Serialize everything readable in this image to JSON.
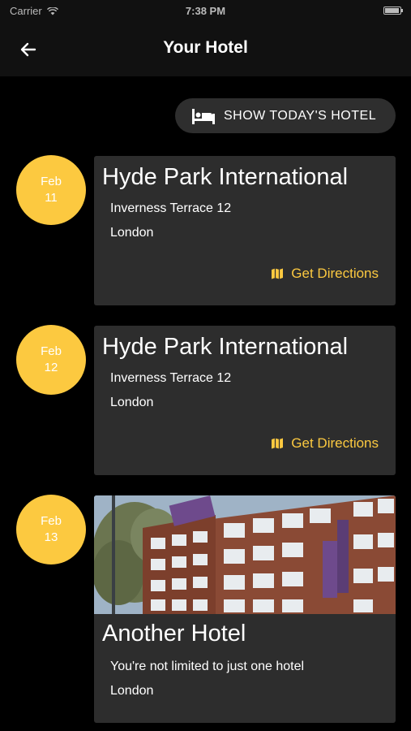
{
  "status": {
    "carrier": "Carrier",
    "time": "7:38 PM"
  },
  "nav": {
    "title": "Your Hotel"
  },
  "today_button": {
    "label": "SHOW TODAY'S HOTEL",
    "icon": "bed-icon"
  },
  "colors": {
    "accent": "#fcc940",
    "card": "#2d2d2d",
    "background": "#000000"
  },
  "bookings": [
    {
      "date": {
        "month": "Feb",
        "day": "11"
      },
      "hotel": "Hyde Park International",
      "line1": "Inverness Terrace 12",
      "line2": "London",
      "action": "Get Directions"
    },
    {
      "date": {
        "month": "Feb",
        "day": "12"
      },
      "hotel": "Hyde Park International",
      "line1": "Inverness Terrace 12",
      "line2": "London",
      "action": "Get Directions"
    },
    {
      "date": {
        "month": "Feb",
        "day": "13"
      },
      "hotel": "Another Hotel",
      "line1": "You're not limited to just one hotel",
      "line2": "London",
      "photo": "hotel-building-photo"
    }
  ]
}
